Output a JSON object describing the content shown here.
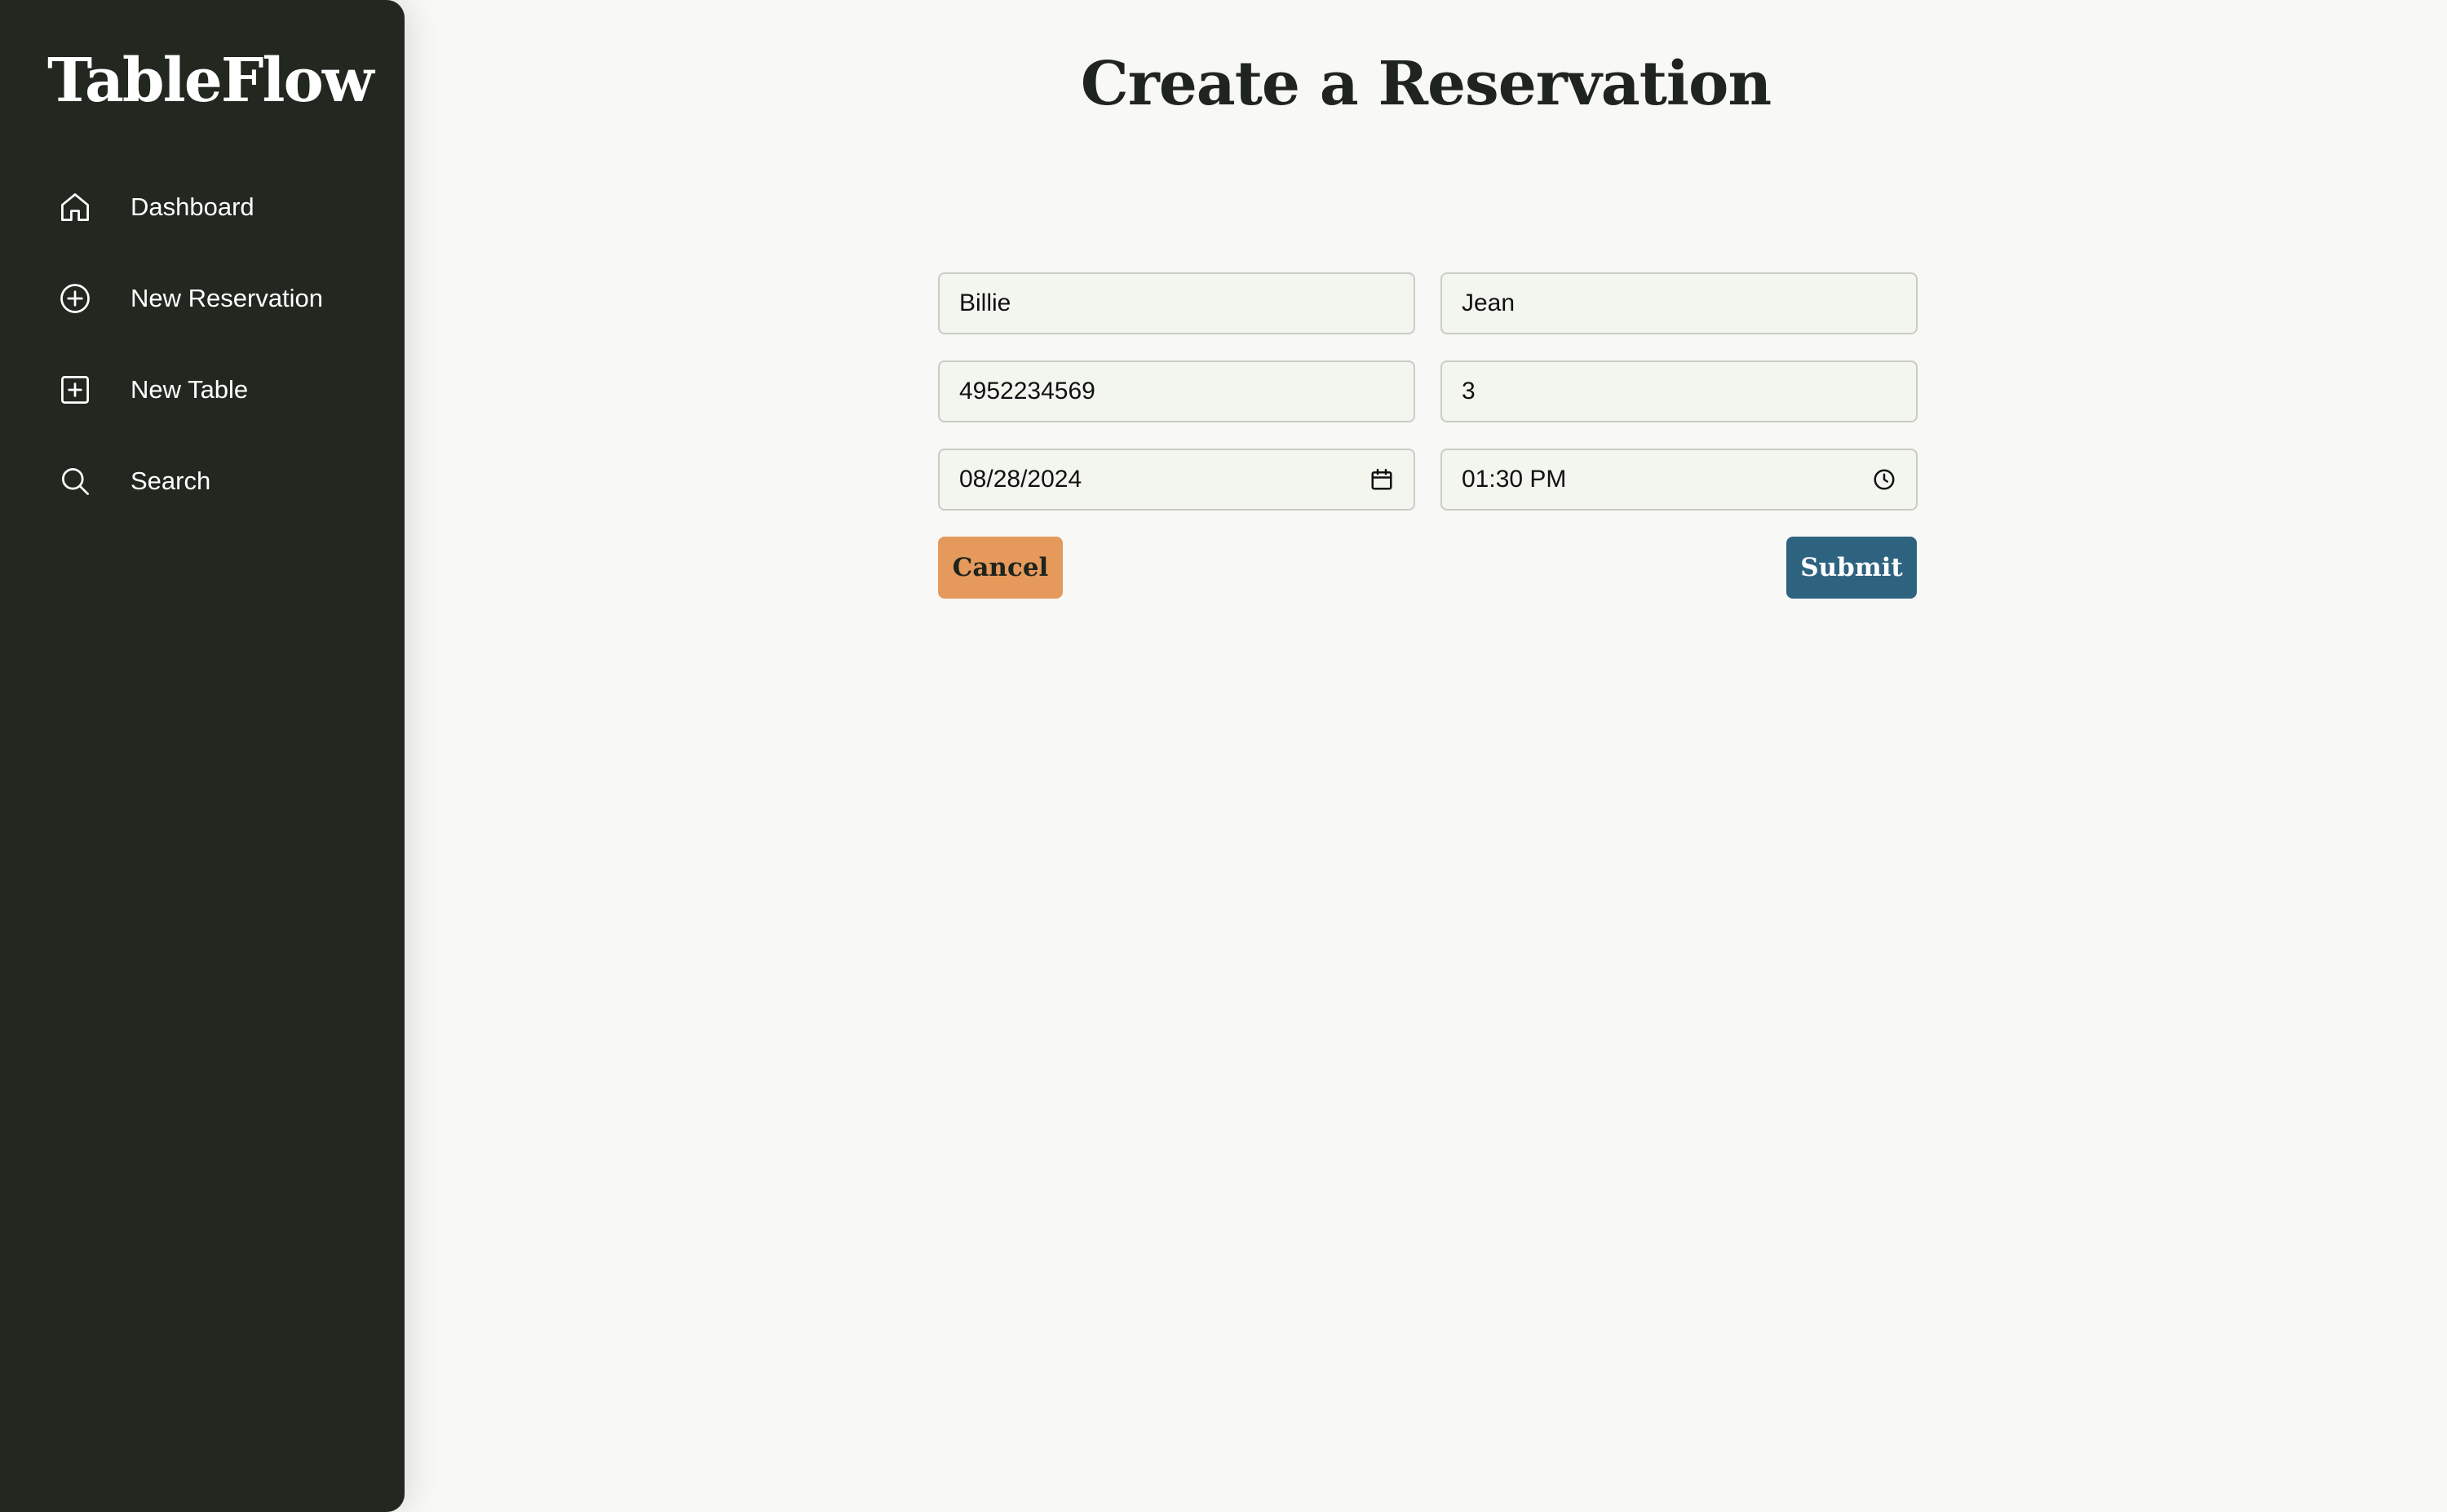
{
  "sidebar": {
    "brand": "TableFlow",
    "items": [
      {
        "label": "Dashboard",
        "icon": "home-icon"
      },
      {
        "label": "New Reservation",
        "icon": "plus-circle-icon"
      },
      {
        "label": "New Table",
        "icon": "plus-square-icon"
      },
      {
        "label": "Search",
        "icon": "search-icon"
      }
    ]
  },
  "main": {
    "title": "Create a Reservation",
    "form": {
      "first_name": "Billie",
      "last_name": "Jean",
      "phone": "4952234569",
      "party_size": "3",
      "date": "08/28/2024",
      "time": "01:30 PM",
      "cancel_label": "Cancel",
      "submit_label": "Submit"
    }
  },
  "colors": {
    "sidebar_bg": "#222720",
    "page_bg": "#f8f8f6",
    "cancel_button": "#e59a5b",
    "submit_button": "#2e6380"
  }
}
